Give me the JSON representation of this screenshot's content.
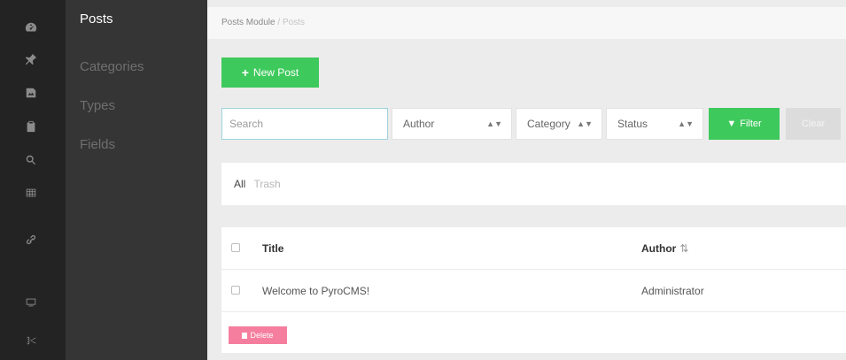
{
  "rail": {
    "icons": [
      "dashboard-icon",
      "pin-icon",
      "image-icon",
      "clipboard-icon",
      "search-icon",
      "grid-icon",
      "link-icon",
      "monitor-icon",
      "scissors-icon"
    ]
  },
  "subnav": {
    "items": [
      {
        "label": "Posts",
        "active": true
      },
      {
        "label": "Categories",
        "active": false
      },
      {
        "label": "Types",
        "active": false
      },
      {
        "label": "Fields",
        "active": false
      }
    ]
  },
  "breadcrumb": {
    "module": "Posts Module",
    "separator": "/",
    "current": "Posts"
  },
  "toolbar": {
    "new_post_label": "New Post"
  },
  "filters": {
    "search_placeholder": "Search",
    "author_label": "Author",
    "category_label": "Category",
    "status_label": "Status",
    "filter_label": "Filter",
    "clear_label": "Clear"
  },
  "views": {
    "all_label": "All",
    "trash_label": "Trash"
  },
  "table": {
    "columns": [
      "Title",
      "Author"
    ],
    "rows": [
      {
        "title": "Welcome to PyroCMS!",
        "author": "Administrator"
      }
    ],
    "delete_label": "Delete"
  },
  "colors": {
    "accent_green": "#3ec95c",
    "danger_pink": "#f57e9e",
    "rail_bg": "#232323",
    "subnav_bg": "#353535"
  }
}
